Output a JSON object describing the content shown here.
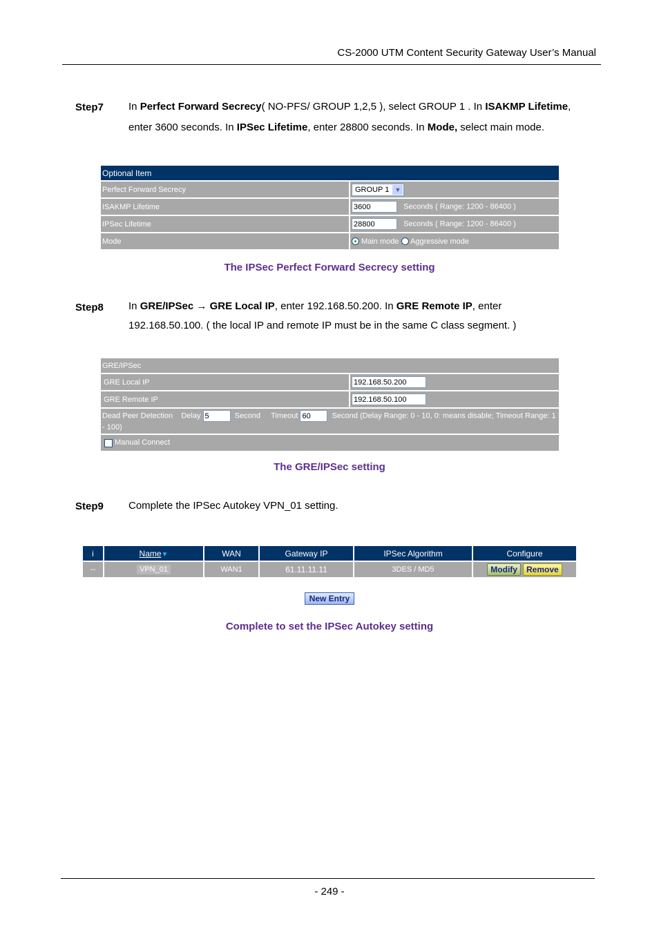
{
  "header": {
    "title": "CS-2000  UTM  Content  Security  Gateway  User’s  Manual"
  },
  "step7": {
    "label": "Step7",
    "line1": [
      "In ",
      "Perfect Forward Secrecy",
      "( NO-PFS/ GROUP 1,2,5 ), select GROUP 1 . In ",
      "ISAKMP Lifetime",
      ","
    ],
    "line2": [
      "enter 3600 seconds.    In ",
      "IPSec Lifetime",
      ", enter 28800 seconds. In ",
      "Mode,",
      " select main mode."
    ]
  },
  "optional": {
    "title": "Optional Item",
    "pfs_label": "Perfect Forward Secrecy",
    "pfs_value": "GROUP 1",
    "isakmp_label": "ISAKMP Lifetime",
    "isakmp_value": "3600",
    "isakmp_hint": "Seconds  ( Range: 1200 - 86400 )",
    "ipsec_label": "IPSec Lifetime",
    "ipsec_value": "28800",
    "ipsec_hint": "Seconds  ( Range: 1200 - 86400 )",
    "mode_label": "Mode",
    "mode_main": "Main mode",
    "mode_aggr": "Aggressive mode",
    "mode_selected": "Main mode"
  },
  "caption1": "The IPSec Perfect Forward Secrecy setting",
  "step8": {
    "label": "Step8",
    "line1": [
      "In ",
      "GRE/IPSec",
      " → ",
      "GRE Local IP",
      ", enter 192.168.50.200. In ",
      "GRE Remote IP",
      ", enter"
    ],
    "line2": "192.168.50.100. (   the local IP and remote IP must be in the same C class segment.   )"
  },
  "gre": {
    "title": "GRE/IPSec",
    "local_label": "GRE Local IP",
    "local_value": "192.168.50.200",
    "remote_label": "GRE Remote IP",
    "remote_value": "192.168.50.100",
    "dpd_label": "Dead Peer Detection",
    "delay_label": "Delay",
    "delay_value": "5",
    "second1": "Second",
    "timeout_label": "Timeout",
    "timeout_value": "60",
    "dpd_hint": "Second (Delay Range: 0 - 10, 0: means disable; Timeout Range: 1 - 100)",
    "manual_connect": "Manual Connect",
    "manual_checked": false
  },
  "caption2": "The GRE/IPSec setting",
  "step9": {
    "label": "Step9",
    "text": "Complete the IPSec Autokey VPN_01 setting."
  },
  "vpn_table": {
    "columns": [
      "i",
      "Name",
      "WAN",
      "Gateway IP",
      "IPSec Algorithm",
      "Configure"
    ],
    "rows": [
      {
        "i": "--",
        "name": "VPN_01",
        "wan": "WAN1",
        "gateway": "61.11.11.11",
        "algorithm": "3DES / MD5",
        "modify": "Modify",
        "remove": "Remove"
      }
    ],
    "new_entry": "New Entry"
  },
  "caption3": "Complete to set the IPSec Autokey setting",
  "footer": {
    "page": "- 249 -"
  }
}
